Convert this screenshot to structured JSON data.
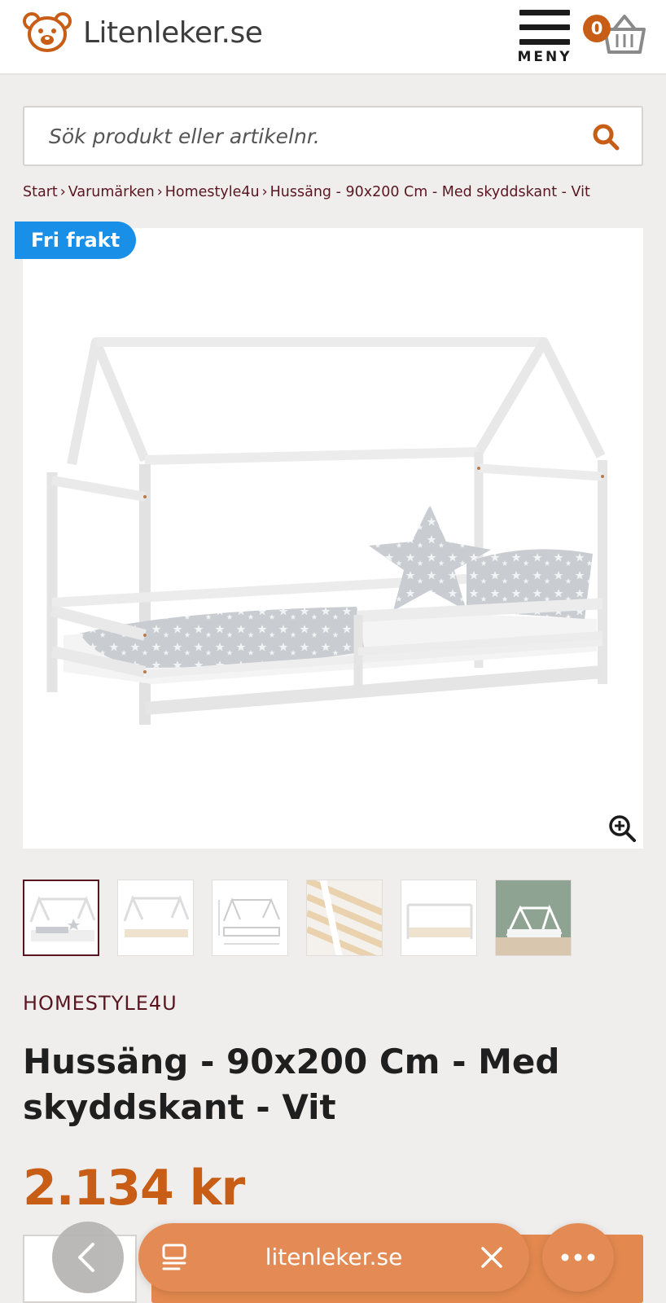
{
  "header": {
    "logo_text": "Litenleker.se",
    "menu_label": "MENY",
    "cart_count": "0"
  },
  "search": {
    "placeholder": "Sök produkt eller artikelnr."
  },
  "breadcrumb": {
    "items": [
      "Start",
      "Varumärken",
      "Homestyle4u",
      "Hussäng - 90x200 Cm - Med skyddskant - Vit"
    ],
    "separator": "›"
  },
  "product": {
    "badge": "Fri frakt",
    "brand": "HOMESTYLE4U",
    "title": "Hussäng - 90x200 Cm - Med skyddskant - Vit",
    "price": "2.134 kr",
    "image_alt": "white house bed with grey star bedding"
  },
  "colors": {
    "accent": "#c85d16",
    "brand_text": "#5a1620",
    "badge_blue": "#1a8fe8"
  },
  "browser": {
    "url": "litenleker.se"
  }
}
